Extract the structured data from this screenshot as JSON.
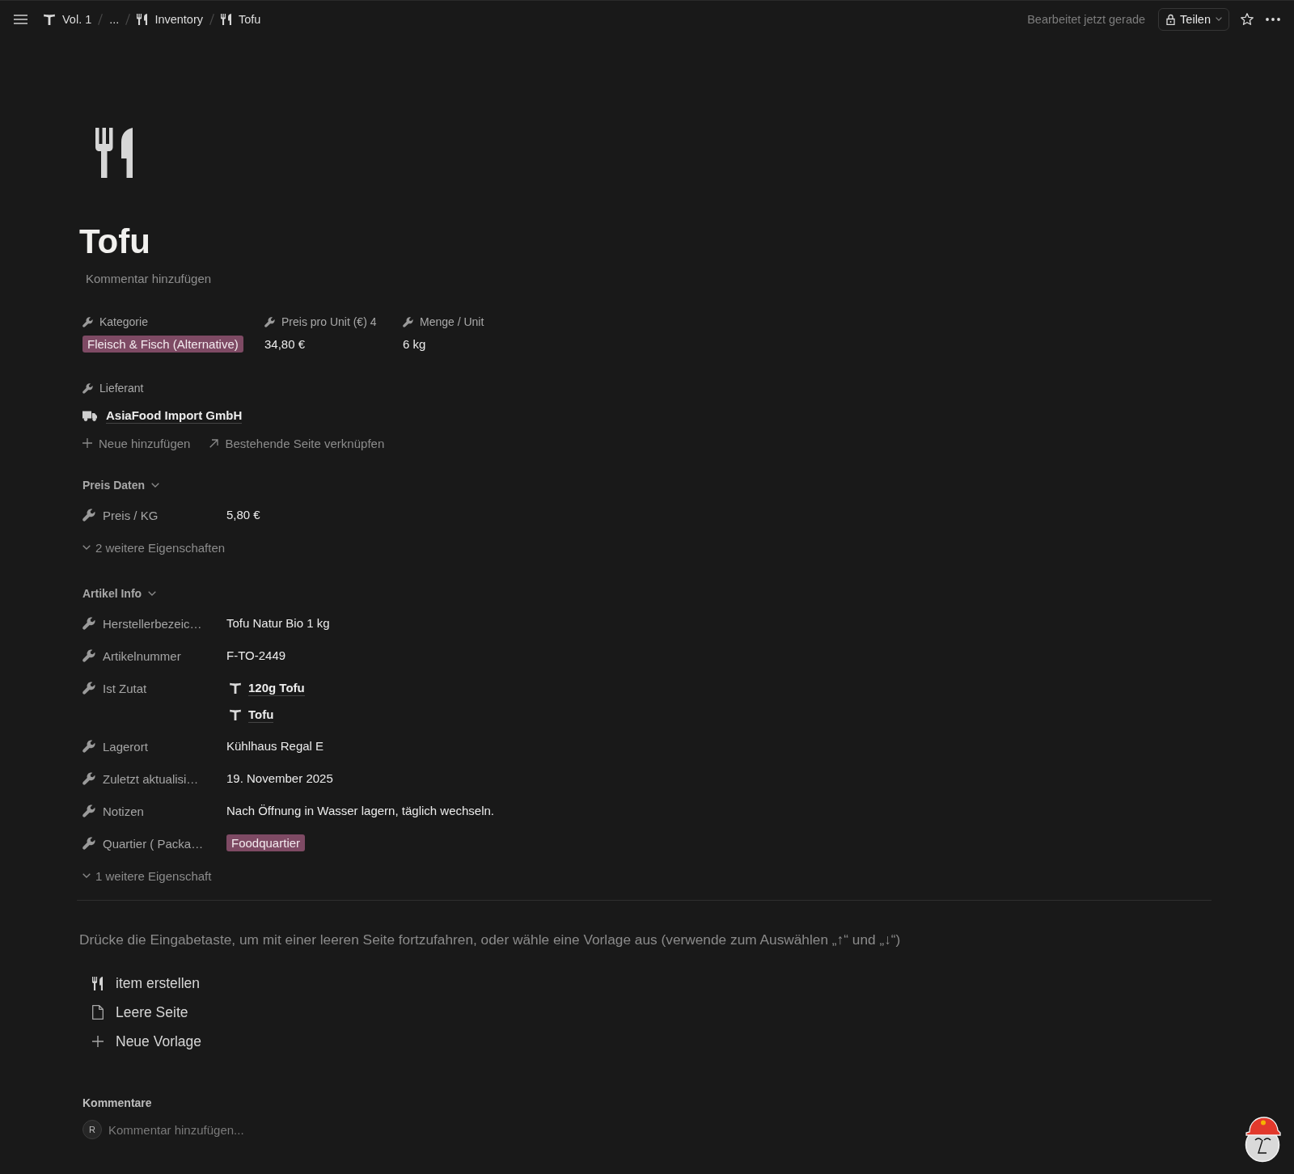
{
  "topbar": {
    "breadcrumbs": [
      {
        "kind": "tee",
        "label": "Vol. 1"
      },
      {
        "kind": "plain",
        "label": "..."
      },
      {
        "kind": "cutlery",
        "label": "Inventory"
      },
      {
        "kind": "cutlery",
        "label": "Tofu"
      }
    ],
    "status": "Bearbeitet jetzt gerade",
    "share_button": "Teilen"
  },
  "page": {
    "title": "Tofu",
    "comment_prompt": "Kommentar hinzufügen"
  },
  "header_properties": [
    {
      "label": "Kategorie",
      "kind": "tag",
      "values": [
        "Fleisch & Fisch (Alternative)"
      ]
    },
    {
      "label": "Preis pro Unit (€) 4",
      "kind": "text",
      "values": [
        "34,80 €"
      ]
    },
    {
      "label": "Menge / Unit",
      "kind": "text",
      "values": [
        "6 kg"
      ]
    }
  ],
  "supplier": {
    "label": "Lieferant",
    "links": [
      "AsiaFood Import GmbH"
    ],
    "actions": [
      {
        "kind": "add",
        "label": "Neue hinzufügen"
      },
      {
        "kind": "link",
        "label": "Bestehende Seite verknüpfen"
      }
    ]
  },
  "sections": [
    {
      "title": "Preis Daten",
      "expanded": true,
      "properties": [
        {
          "label": "Preis / KG",
          "kind": "text",
          "values": [
            "5,80 €"
          ]
        }
      ],
      "more": "2 weitere Eigenschaften"
    },
    {
      "title": "Artikel Info",
      "expanded": true,
      "properties": [
        {
          "label": "Herstellerbezeic…",
          "kind": "text",
          "values": [
            "Tofu Natur Bio 1 kg"
          ]
        },
        {
          "label": "Artikelnummer",
          "kind": "text",
          "values": [
            "F-TO-2449"
          ]
        },
        {
          "label": "Ist Zutat",
          "kind": "relation",
          "values": [
            "120g Tofu",
            "Tofu"
          ]
        },
        {
          "label": "Lagerort",
          "kind": "text",
          "values": [
            "Kühlhaus Regal E"
          ]
        },
        {
          "label": "Zuletzt aktualisi…",
          "kind": "text",
          "values": [
            "19. November 2025"
          ]
        },
        {
          "label": "Notizen",
          "kind": "text",
          "values": [
            "Nach Öffnung in Wasser lagern, täglich wechseln."
          ]
        },
        {
          "label": "Quartier ( Packa…",
          "kind": "tag",
          "values": [
            "Foodquartier"
          ]
        }
      ],
      "more": "1 weitere Eigenschaft"
    }
  ],
  "template_hint": "Drücke die Eingabetaste, um mit einer leeren Seite fortzufahren, oder wähle eine Vorlage aus (verwende zum Auswählen „↑“ und „↓“)",
  "templates": [
    {
      "kind": "cutlery",
      "label": "item erstellen"
    },
    {
      "kind": "page",
      "label": "Leere Seite"
    },
    {
      "kind": "plus",
      "label": "Neue Vorlage"
    }
  ],
  "comments": {
    "title": "Kommentare",
    "avatar_initial": "R",
    "placeholder": "Kommentar hinzufügen..."
  }
}
